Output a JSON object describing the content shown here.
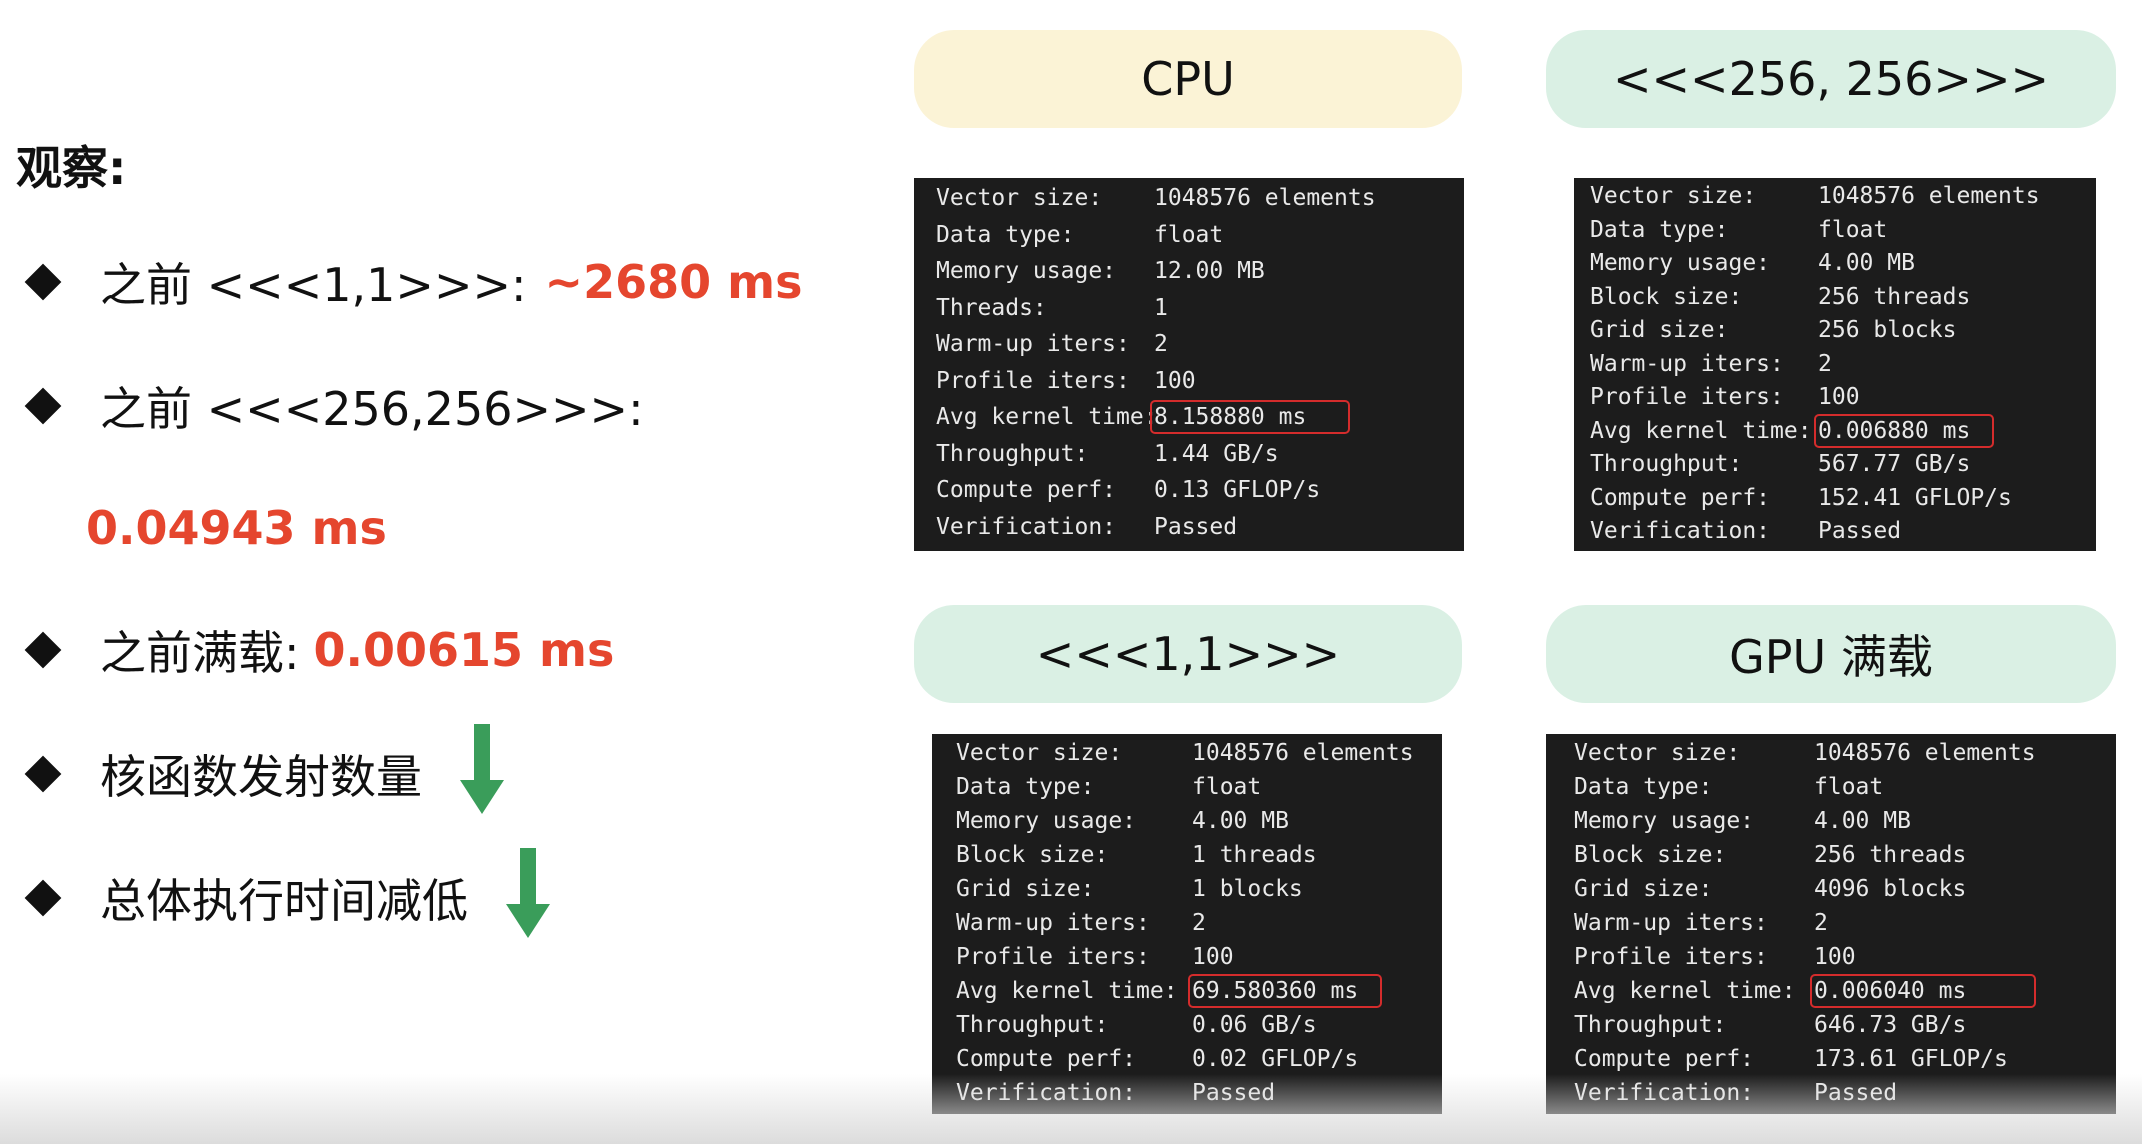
{
  "observations": {
    "heading": "观察:",
    "items": [
      {
        "label": "之前 <<<1,1>>>:",
        "value": "~2680 ms"
      },
      {
        "label": "之前 <<<256,256>>>:",
        "value": ""
      },
      {
        "label": "",
        "value": "0.04943 ms"
      },
      {
        "label": "之前满载:",
        "value": "0.00615 ms"
      },
      {
        "label": "核函数发射数量",
        "value": ""
      },
      {
        "label": "总体执行时间减低",
        "value": ""
      }
    ]
  },
  "panels": [
    {
      "title": "CPU",
      "lines": [
        {
          "key": "Vector size:",
          "value": "1048576 elements"
        },
        {
          "key": "Data type:",
          "value": "float"
        },
        {
          "key": "Memory usage:",
          "value": "12.00 MB"
        },
        {
          "key": "Threads:",
          "value": "1"
        },
        {
          "key": "Warm-up iters:",
          "value": "2"
        },
        {
          "key": "Profile iters:",
          "value": "100"
        },
        {
          "key": "Avg kernel time:",
          "value": "8.158880 ms"
        },
        {
          "key": "Throughput:",
          "value": "1.44 GB/s"
        },
        {
          "key": "Compute perf:",
          "value": "0.13 GFLOP/s"
        },
        {
          "key": "Verification:",
          "value": "Passed"
        }
      ]
    },
    {
      "title": "<<<256, 256>>>",
      "lines": [
        {
          "key": "Vector size:",
          "value": "1048576 elements"
        },
        {
          "key": "Data type:",
          "value": "float"
        },
        {
          "key": "Memory usage:",
          "value": "4.00 MB"
        },
        {
          "key": "Block size:",
          "value": "256 threads"
        },
        {
          "key": "Grid size:",
          "value": "256 blocks"
        },
        {
          "key": "Warm-up iters:",
          "value": "2"
        },
        {
          "key": "Profile iters:",
          "value": "100"
        },
        {
          "key": "Avg kernel time:",
          "value": "0.006880 ms"
        },
        {
          "key": "Throughput:",
          "value": "567.77 GB/s"
        },
        {
          "key": "Compute perf:",
          "value": "152.41 GFLOP/s"
        },
        {
          "key": "Verification:",
          "value": "Passed"
        }
      ]
    },
    {
      "title": "<<<1,1>>>",
      "lines": [
        {
          "key": "Vector size:",
          "value": "1048576 elements"
        },
        {
          "key": "Data type:",
          "value": "float"
        },
        {
          "key": "Memory usage:",
          "value": "4.00 MB"
        },
        {
          "key": "Block size:",
          "value": "1 threads"
        },
        {
          "key": "Grid size:",
          "value": "1 blocks"
        },
        {
          "key": "Warm-up iters:",
          "value": "2"
        },
        {
          "key": "Profile iters:",
          "value": "100"
        },
        {
          "key": "Avg kernel time:",
          "value": "69.580360 ms"
        },
        {
          "key": "Throughput:",
          "value": "0.06 GB/s"
        },
        {
          "key": "Compute perf:",
          "value": "0.02 GFLOP/s"
        },
        {
          "key": "Verification:",
          "value": "Passed"
        }
      ]
    },
    {
      "title": "GPU 满载",
      "lines": [
        {
          "key": "Vector size:",
          "value": "1048576 elements"
        },
        {
          "key": "Data type:",
          "value": "float"
        },
        {
          "key": "Memory usage:",
          "value": "4.00 MB"
        },
        {
          "key": "Block size:",
          "value": "256 threads"
        },
        {
          "key": "Grid size:",
          "value": "4096 blocks"
        },
        {
          "key": "Warm-up iters:",
          "value": "2"
        },
        {
          "key": "Profile iters:",
          "value": "100"
        },
        {
          "key": "Avg kernel time:",
          "value": "0.006040 ms"
        },
        {
          "key": "Throughput:",
          "value": "646.73 GB/s"
        },
        {
          "key": "Compute perf:",
          "value": "173.61 GFLOP/s"
        },
        {
          "key": "Verification:",
          "value": "Passed"
        }
      ]
    }
  ],
  "colors": {
    "accent": "#e5462e",
    "arrow": "#3a9d5a",
    "pill_cpu": "#fbf3d6",
    "pill_gpu": "#daf0e4",
    "terminal_bg": "#1c1c1c",
    "highlight": "#d42c2c"
  },
  "icons": {
    "diamond": "diamond-bullet-icon",
    "arrow": "arrow-down-icon"
  }
}
